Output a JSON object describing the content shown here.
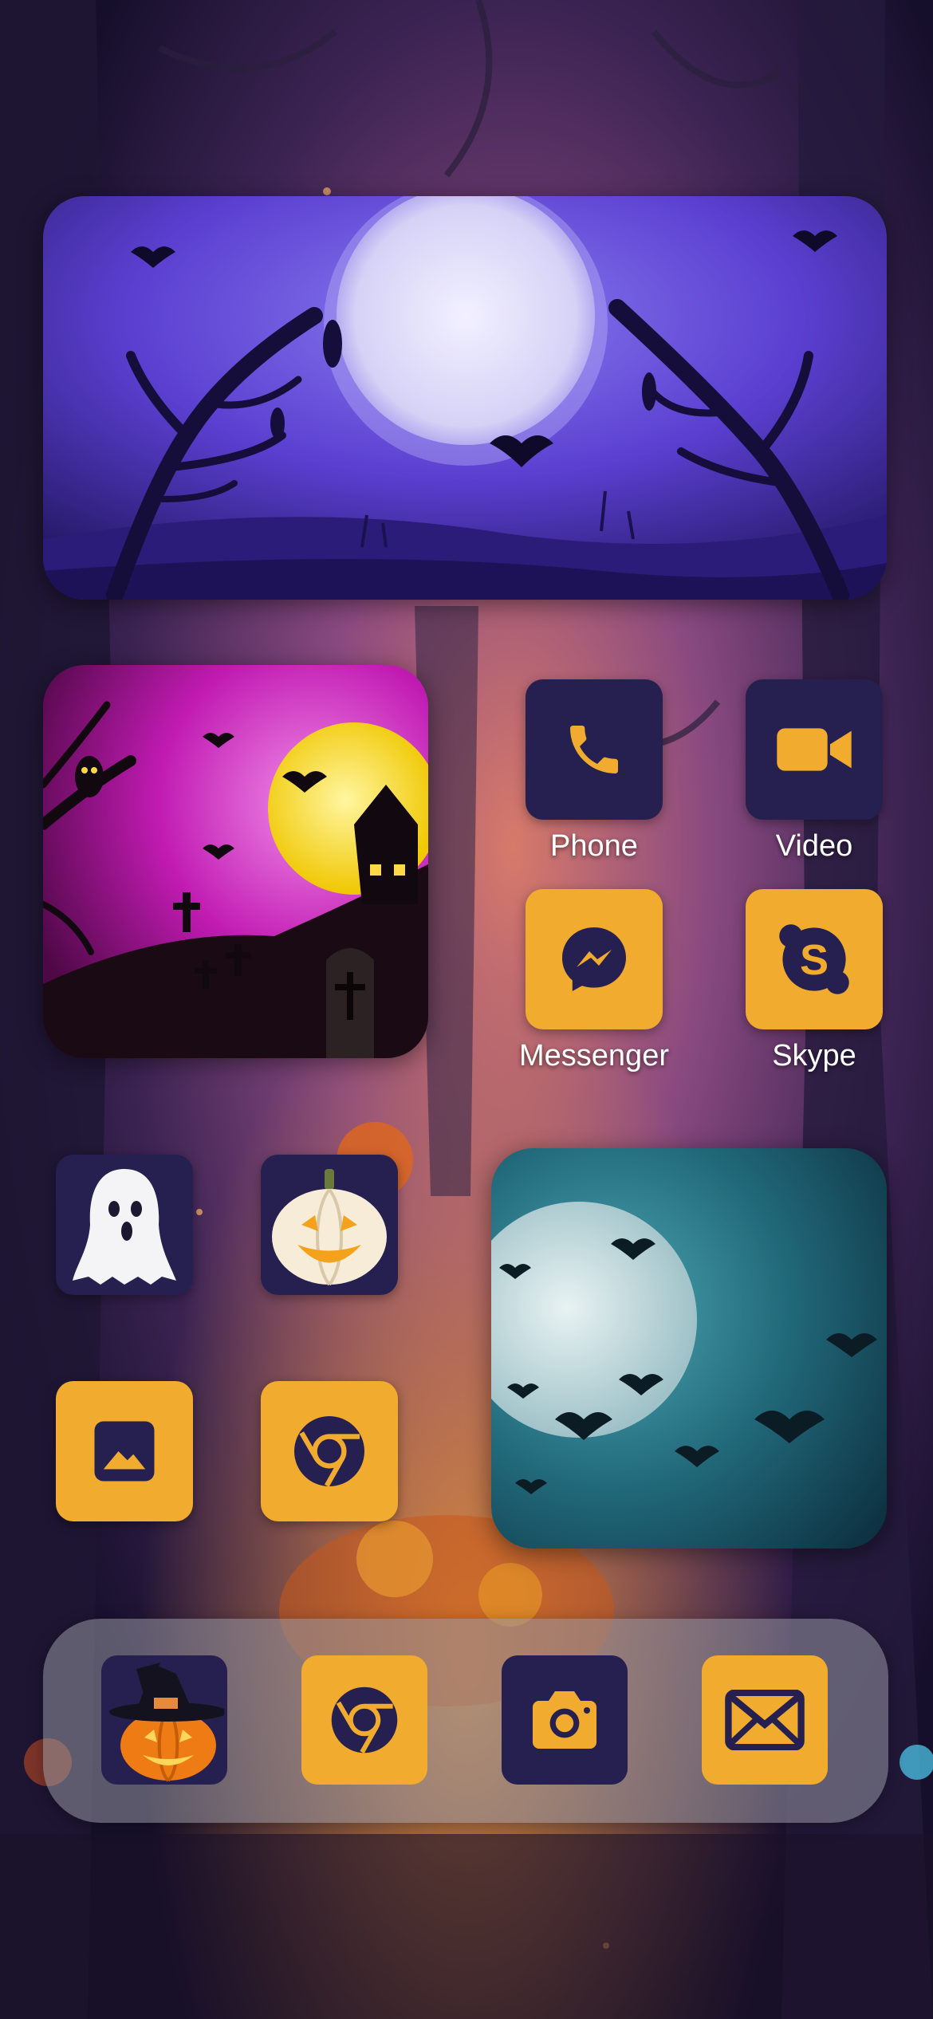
{
  "screen": {
    "name": "Halloween themed iOS home screen"
  },
  "apps": [
    {
      "id": "phone",
      "label": "Phone",
      "icon": "phone-icon"
    },
    {
      "id": "video",
      "label": "Video",
      "icon": "video-camera-icon"
    },
    {
      "id": "messenger",
      "label": "Messenger",
      "icon": "messenger-icon"
    },
    {
      "id": "skype",
      "label": "Skype",
      "icon": "skype-icon"
    }
  ],
  "unlabeled_apps": [
    {
      "icon": "ghost-icon"
    },
    {
      "icon": "jack-o-lantern-icon"
    },
    {
      "icon": "photos-icon"
    },
    {
      "icon": "chrome-icon"
    }
  ],
  "dock": [
    {
      "icon": "witch-pumpkin-icon"
    },
    {
      "icon": "chrome-icon"
    },
    {
      "icon": "camera-icon"
    },
    {
      "icon": "mail-icon"
    }
  ],
  "colors": {
    "tile_navy": "#25204f",
    "tile_amber": "#f1ab2f",
    "label_text": "#ffffff"
  }
}
